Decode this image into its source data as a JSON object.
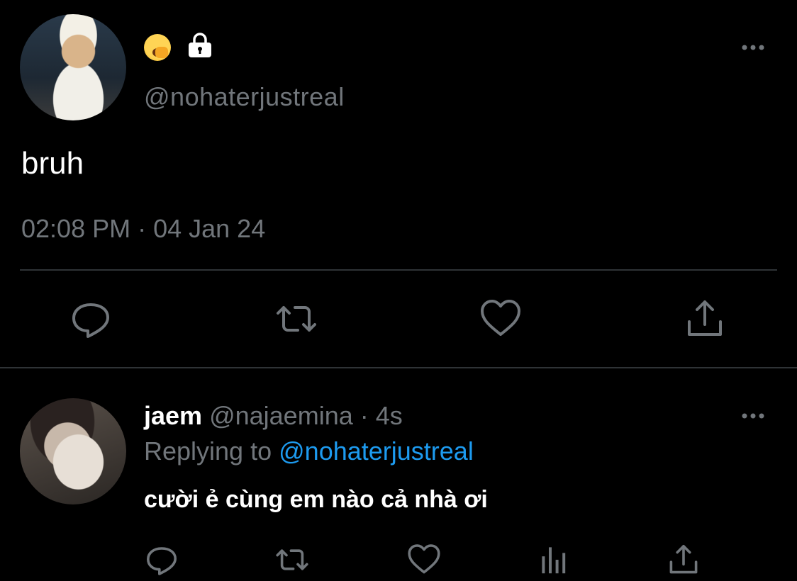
{
  "main_tweet": {
    "handle": "@nohaterjustreal",
    "text": "bruh",
    "timestamp": "02:08 PM · 04 Jan 24",
    "actions": [
      "reply-icon",
      "retweet-icon",
      "like-icon",
      "share-icon"
    ]
  },
  "reply": {
    "name": "jaem",
    "handle": "@najaemina",
    "time": "· 4s",
    "replying_label": "Replying to",
    "replying_to": "@nohaterjustreal",
    "text": "cười ẻ cùng em nào cả nhà ơi",
    "actions": [
      "reply-icon",
      "retweet-icon",
      "like-icon",
      "analytics-icon",
      "share-icon"
    ]
  },
  "colors": {
    "background": "#000000",
    "primary_text": "#ffffff",
    "secondary_text": "#71767b",
    "mention": "#1d9bf0",
    "divider": "#2f3336"
  }
}
